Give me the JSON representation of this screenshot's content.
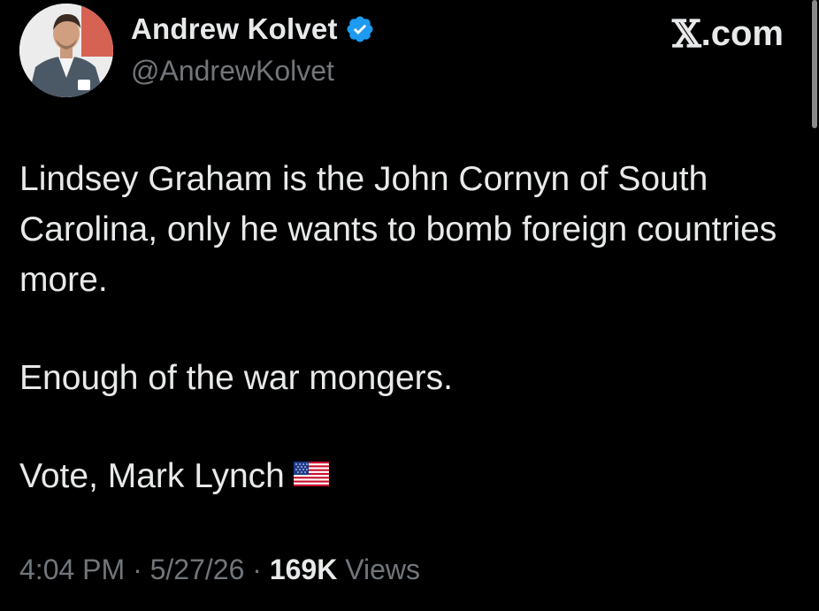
{
  "author": {
    "display_name": "Andrew Kolvet",
    "handle": "@AndrewKolvet",
    "verified": true,
    "badge_color": "#1d9bf0"
  },
  "brand": {
    "label": ".com"
  },
  "tweet": {
    "paragraphs": [
      "Lindsey Graham is the John Cornyn of South Carolina, only he wants to bomb foreign countries more.",
      "Enough of the war mongers.",
      "Vote, Mark Lynch"
    ],
    "flag_icon": "us-flag-icon"
  },
  "meta": {
    "time": "4:04 PM",
    "separator": "·",
    "date": "5/27/26",
    "views_count": "169K",
    "views_label": "Views"
  },
  "colors": {
    "background": "#000000",
    "primary_text": "#e7e9ea",
    "secondary_text": "#71767b"
  }
}
